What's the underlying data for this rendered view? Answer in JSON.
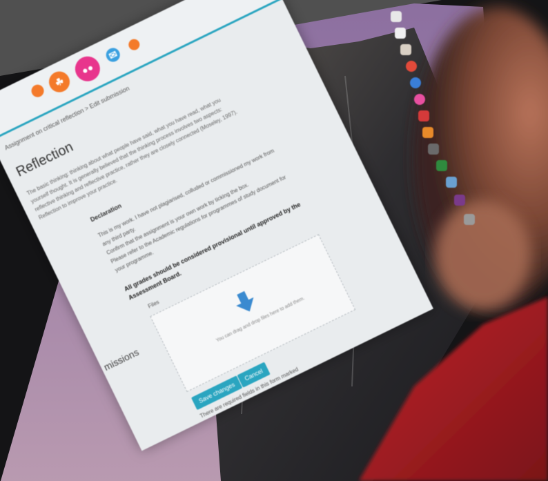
{
  "screen": {
    "breadcrumb": "Assignment on critical reflection > Edit submission",
    "title": "Reflection",
    "description": "The basic thinking: thinking about what people have said, what you have read, what you yourself thought. It is generally believed that the thinking process involves two aspects: reflective thinking and reflective practice, rather they are closely connected (Moseley, 1997).",
    "description_end": "Reflection to improve your practice.",
    "declaration": {
      "title": "Declaration",
      "line1": "This is my work. I have not plagiarised, colluded or commissioned my work from any third party.",
      "line2": "Confirm that the assignment is your own work by ticking the box.",
      "line3": "Please refer to the Academic regulations for programmes of study document for your programme.",
      "bold": "All grades should be considered provisional until approved by the Assessment Board."
    },
    "submissions_label": "missions",
    "files_label": "Files",
    "upload_hint": "You can drag and drop files here to add them.",
    "save_button": "Save changes",
    "cancel_button": "Cancel",
    "required_note": "There are required fields in this form marked"
  },
  "colors": {
    "accent": "#2aa5c0",
    "icon_orange": "#f47a2a",
    "icon_pink": "#e8358c",
    "icon_blue": "#3aa0e0"
  }
}
